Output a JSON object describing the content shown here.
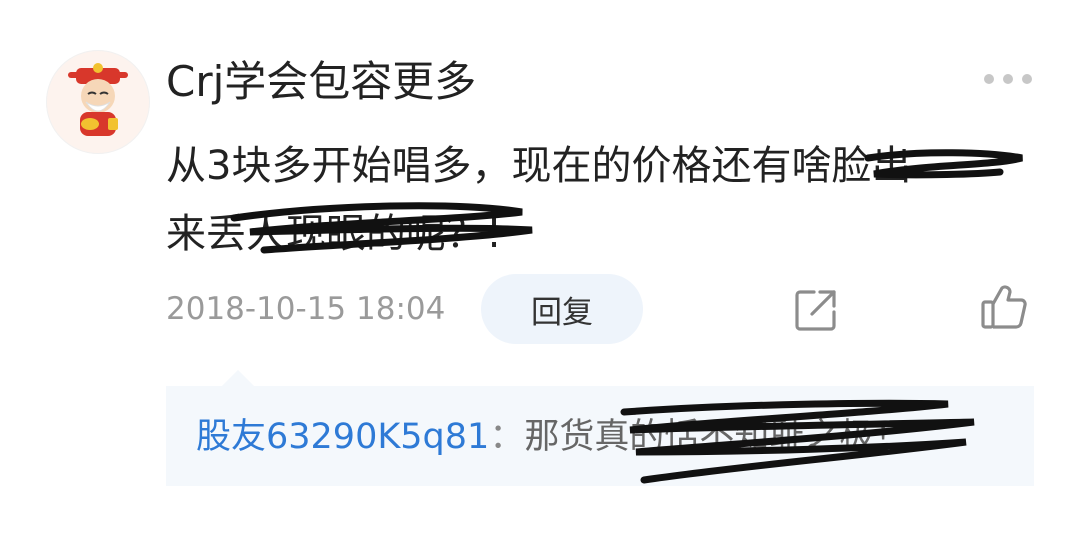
{
  "comment": {
    "author": "Crj学会包容更多",
    "text_line1": "从3块多开始唱多，现在的价格还有",
    "text_line1_struck": "啥脸出",
    "text_line2_plain": "来丢",
    "text_line2_struck": "人现眼的呢？!",
    "timestamp": "2018-10-15 18:04",
    "reply_label": "回复"
  },
  "reply": {
    "author": "股友63290K5q81",
    "separator": "：",
    "text": "那货真的恬不知耻之极！"
  },
  "icons": {
    "more": "more-dots-icon",
    "share": "share-icon",
    "like": "thumbs-up-icon",
    "avatar": "caishen-avatar"
  },
  "colors": {
    "reply_author": "#2e7ad6",
    "reply_bg": "#f4f8fc",
    "reply_button_bg": "#eef4fb",
    "meta_text": "#9a9a9a",
    "scribble": "#111111"
  }
}
